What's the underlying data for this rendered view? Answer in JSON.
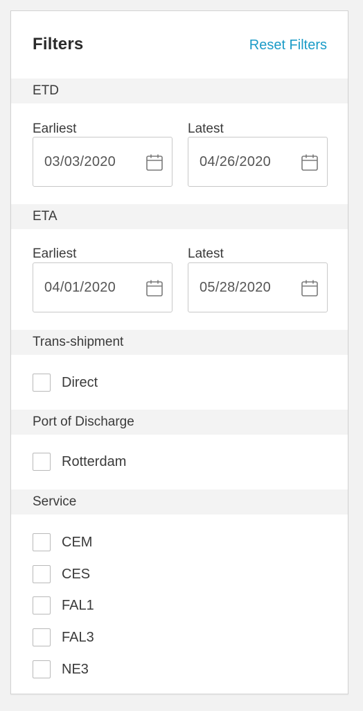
{
  "header": {
    "title": "Filters",
    "reset_label": "Reset Filters"
  },
  "etd": {
    "heading": "ETD",
    "earliest_label": "Earliest",
    "earliest_value": "03/03/2020",
    "latest_label": "Latest",
    "latest_value": "04/26/2020"
  },
  "eta": {
    "heading": "ETA",
    "earliest_label": "Earliest",
    "earliest_value": "04/01/2020",
    "latest_label": "Latest",
    "latest_value": "05/28/2020"
  },
  "transshipment": {
    "heading": "Trans-shipment",
    "options": [
      {
        "label": "Direct",
        "checked": false
      }
    ]
  },
  "port_of_discharge": {
    "heading": "Port of Discharge",
    "options": [
      {
        "label": "Rotterdam",
        "checked": false
      }
    ]
  },
  "service": {
    "heading": "Service",
    "options": [
      {
        "label": "CEM",
        "checked": false
      },
      {
        "label": "CES",
        "checked": false
      },
      {
        "label": "FAL1",
        "checked": false
      },
      {
        "label": "FAL3",
        "checked": false
      },
      {
        "label": "NE3",
        "checked": false
      }
    ]
  },
  "colors": {
    "accent": "#1a9bc7",
    "section_bg": "#f3f3f3",
    "border": "#c8c8c8"
  },
  "icons": {
    "date_picker": "calendar-icon"
  }
}
